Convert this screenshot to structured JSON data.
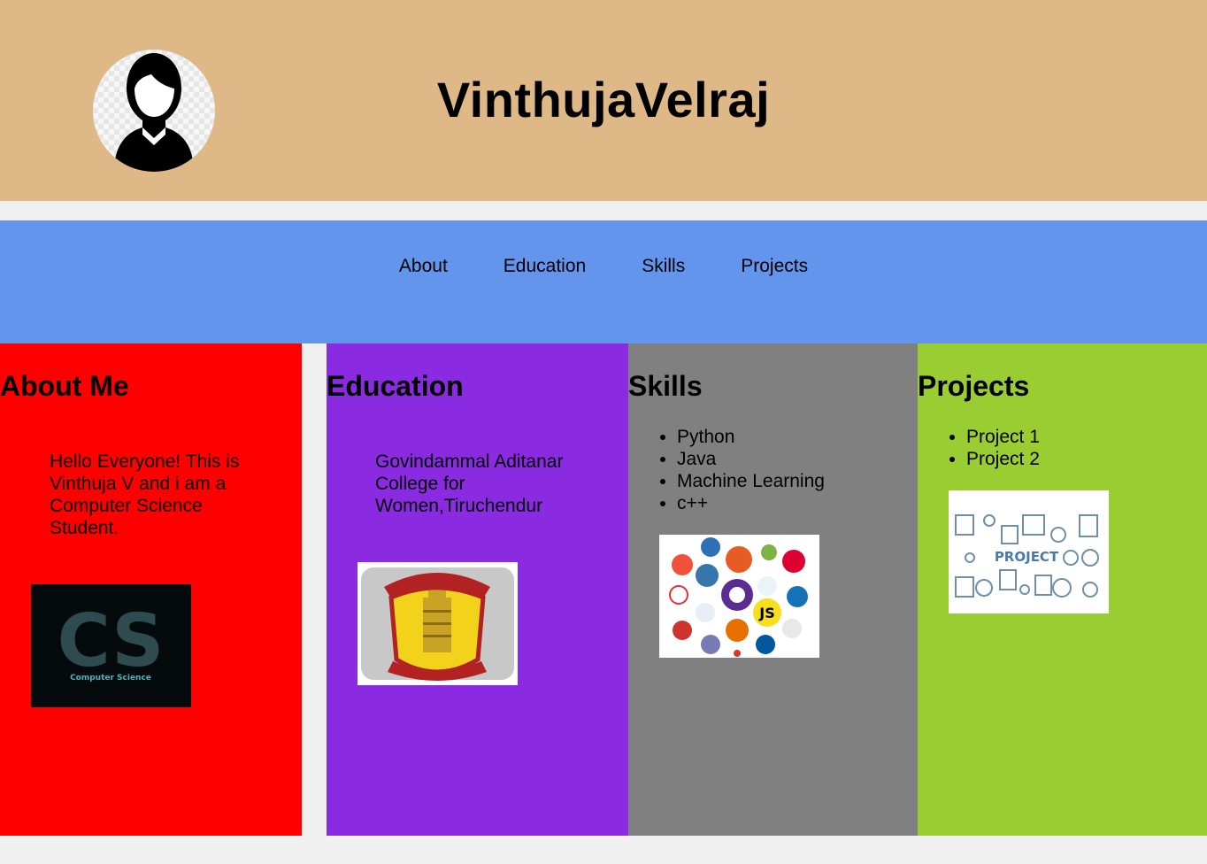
{
  "header": {
    "title": "VinthujaVelraj",
    "avatar_icon": "person-silhouette-icon",
    "bg_color": "#deb887"
  },
  "nav": {
    "bg_color": "#6495ed",
    "links": [
      {
        "label": "About"
      },
      {
        "label": "Education"
      },
      {
        "label": "Skills"
      },
      {
        "label": "Projects"
      }
    ]
  },
  "sections": {
    "about": {
      "heading": "About Me",
      "text": "Hello Everyone! This is Vinthuja V and i am a Computer Science Student.",
      "image_caption": "Computer Science",
      "image_letters": "CS",
      "bg_color": "#ff0000"
    },
    "education": {
      "heading": "Education",
      "text": "Govindammal Aditanar College for Women,Tiruchendur",
      "image_icon": "college-emblem-icon",
      "bg_color": "#8a2be2"
    },
    "skills": {
      "heading": "Skills",
      "items": [
        "Python",
        "Java",
        "Machine Learning",
        "c++"
      ],
      "image_icon": "programming-languages-collage-icon",
      "bg_color": "#808080"
    },
    "projects": {
      "heading": "Projects",
      "items": [
        "Project 1",
        "Project 2"
      ],
      "image_label": "PROJECT",
      "bg_color": "#9acd32"
    }
  }
}
